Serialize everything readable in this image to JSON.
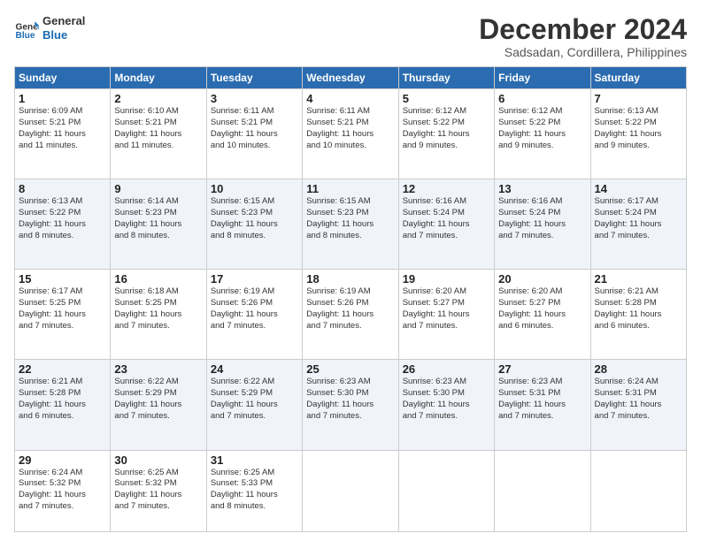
{
  "logo": {
    "line1": "General",
    "line2": "Blue"
  },
  "title": "December 2024",
  "location": "Sadsadan, Cordillera, Philippines",
  "days_header": [
    "Sunday",
    "Monday",
    "Tuesday",
    "Wednesday",
    "Thursday",
    "Friday",
    "Saturday"
  ],
  "weeks": [
    [
      {
        "num": "1",
        "lines": [
          "Sunrise: 6:09 AM",
          "Sunset: 5:21 PM",
          "Daylight: 11 hours",
          "and 11 minutes."
        ]
      },
      {
        "num": "2",
        "lines": [
          "Sunrise: 6:10 AM",
          "Sunset: 5:21 PM",
          "Daylight: 11 hours",
          "and 11 minutes."
        ]
      },
      {
        "num": "3",
        "lines": [
          "Sunrise: 6:11 AM",
          "Sunset: 5:21 PM",
          "Daylight: 11 hours",
          "and 10 minutes."
        ]
      },
      {
        "num": "4",
        "lines": [
          "Sunrise: 6:11 AM",
          "Sunset: 5:21 PM",
          "Daylight: 11 hours",
          "and 10 minutes."
        ]
      },
      {
        "num": "5",
        "lines": [
          "Sunrise: 6:12 AM",
          "Sunset: 5:22 PM",
          "Daylight: 11 hours",
          "and 9 minutes."
        ]
      },
      {
        "num": "6",
        "lines": [
          "Sunrise: 6:12 AM",
          "Sunset: 5:22 PM",
          "Daylight: 11 hours",
          "and 9 minutes."
        ]
      },
      {
        "num": "7",
        "lines": [
          "Sunrise: 6:13 AM",
          "Sunset: 5:22 PM",
          "Daylight: 11 hours",
          "and 9 minutes."
        ]
      }
    ],
    [
      {
        "num": "8",
        "lines": [
          "Sunrise: 6:13 AM",
          "Sunset: 5:22 PM",
          "Daylight: 11 hours",
          "and 8 minutes."
        ]
      },
      {
        "num": "9",
        "lines": [
          "Sunrise: 6:14 AM",
          "Sunset: 5:23 PM",
          "Daylight: 11 hours",
          "and 8 minutes."
        ]
      },
      {
        "num": "10",
        "lines": [
          "Sunrise: 6:15 AM",
          "Sunset: 5:23 PM",
          "Daylight: 11 hours",
          "and 8 minutes."
        ]
      },
      {
        "num": "11",
        "lines": [
          "Sunrise: 6:15 AM",
          "Sunset: 5:23 PM",
          "Daylight: 11 hours",
          "and 8 minutes."
        ]
      },
      {
        "num": "12",
        "lines": [
          "Sunrise: 6:16 AM",
          "Sunset: 5:24 PM",
          "Daylight: 11 hours",
          "and 7 minutes."
        ]
      },
      {
        "num": "13",
        "lines": [
          "Sunrise: 6:16 AM",
          "Sunset: 5:24 PM",
          "Daylight: 11 hours",
          "and 7 minutes."
        ]
      },
      {
        "num": "14",
        "lines": [
          "Sunrise: 6:17 AM",
          "Sunset: 5:24 PM",
          "Daylight: 11 hours",
          "and 7 minutes."
        ]
      }
    ],
    [
      {
        "num": "15",
        "lines": [
          "Sunrise: 6:17 AM",
          "Sunset: 5:25 PM",
          "Daylight: 11 hours",
          "and 7 minutes."
        ]
      },
      {
        "num": "16",
        "lines": [
          "Sunrise: 6:18 AM",
          "Sunset: 5:25 PM",
          "Daylight: 11 hours",
          "and 7 minutes."
        ]
      },
      {
        "num": "17",
        "lines": [
          "Sunrise: 6:19 AM",
          "Sunset: 5:26 PM",
          "Daylight: 11 hours",
          "and 7 minutes."
        ]
      },
      {
        "num": "18",
        "lines": [
          "Sunrise: 6:19 AM",
          "Sunset: 5:26 PM",
          "Daylight: 11 hours",
          "and 7 minutes."
        ]
      },
      {
        "num": "19",
        "lines": [
          "Sunrise: 6:20 AM",
          "Sunset: 5:27 PM",
          "Daylight: 11 hours",
          "and 7 minutes."
        ]
      },
      {
        "num": "20",
        "lines": [
          "Sunrise: 6:20 AM",
          "Sunset: 5:27 PM",
          "Daylight: 11 hours",
          "and 6 minutes."
        ]
      },
      {
        "num": "21",
        "lines": [
          "Sunrise: 6:21 AM",
          "Sunset: 5:28 PM",
          "Daylight: 11 hours",
          "and 6 minutes."
        ]
      }
    ],
    [
      {
        "num": "22",
        "lines": [
          "Sunrise: 6:21 AM",
          "Sunset: 5:28 PM",
          "Daylight: 11 hours",
          "and 6 minutes."
        ]
      },
      {
        "num": "23",
        "lines": [
          "Sunrise: 6:22 AM",
          "Sunset: 5:29 PM",
          "Daylight: 11 hours",
          "and 7 minutes."
        ]
      },
      {
        "num": "24",
        "lines": [
          "Sunrise: 6:22 AM",
          "Sunset: 5:29 PM",
          "Daylight: 11 hours",
          "and 7 minutes."
        ]
      },
      {
        "num": "25",
        "lines": [
          "Sunrise: 6:23 AM",
          "Sunset: 5:30 PM",
          "Daylight: 11 hours",
          "and 7 minutes."
        ]
      },
      {
        "num": "26",
        "lines": [
          "Sunrise: 6:23 AM",
          "Sunset: 5:30 PM",
          "Daylight: 11 hours",
          "and 7 minutes."
        ]
      },
      {
        "num": "27",
        "lines": [
          "Sunrise: 6:23 AM",
          "Sunset: 5:31 PM",
          "Daylight: 11 hours",
          "and 7 minutes."
        ]
      },
      {
        "num": "28",
        "lines": [
          "Sunrise: 6:24 AM",
          "Sunset: 5:31 PM",
          "Daylight: 11 hours",
          "and 7 minutes."
        ]
      }
    ],
    [
      {
        "num": "29",
        "lines": [
          "Sunrise: 6:24 AM",
          "Sunset: 5:32 PM",
          "Daylight: 11 hours",
          "and 7 minutes."
        ]
      },
      {
        "num": "30",
        "lines": [
          "Sunrise: 6:25 AM",
          "Sunset: 5:32 PM",
          "Daylight: 11 hours",
          "and 7 minutes."
        ]
      },
      {
        "num": "31",
        "lines": [
          "Sunrise: 6:25 AM",
          "Sunset: 5:33 PM",
          "Daylight: 11 hours",
          "and 8 minutes."
        ]
      },
      null,
      null,
      null,
      null
    ]
  ]
}
